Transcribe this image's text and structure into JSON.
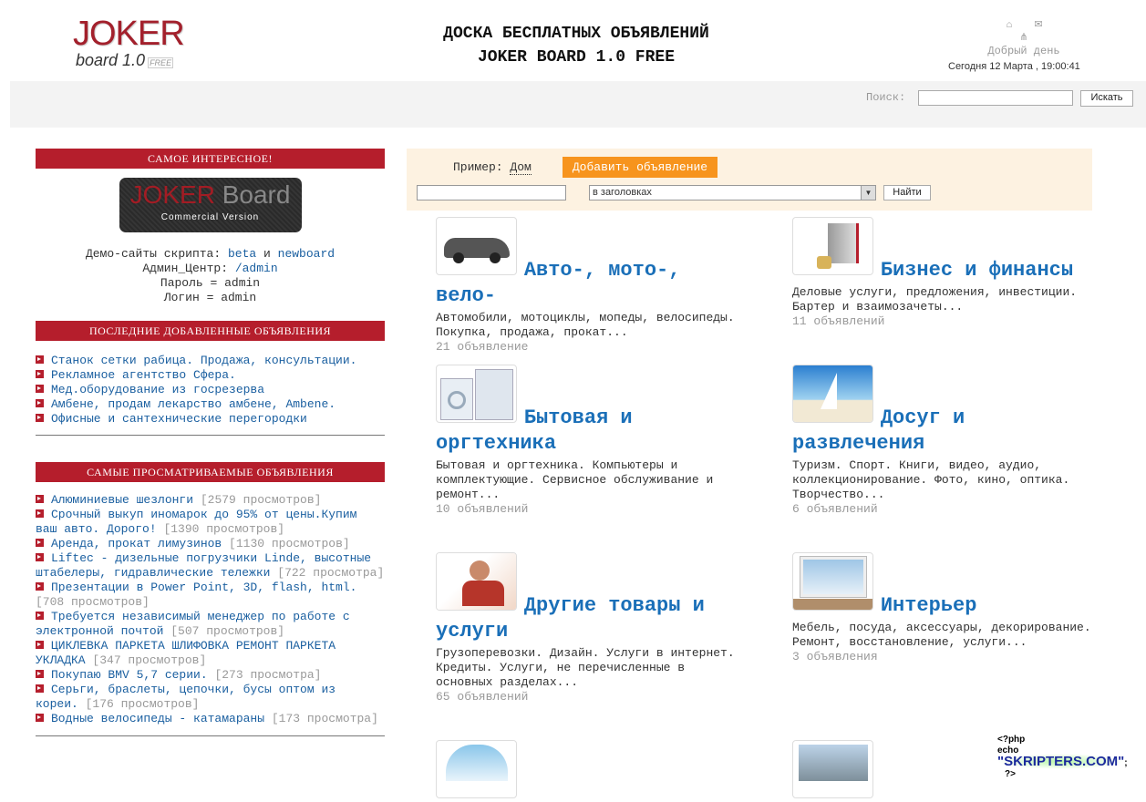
{
  "header": {
    "logo_main": "JOKER",
    "logo_sub": "board 1.0",
    "logo_badge": "FREE",
    "title_line1": "ДОСКА БЕСПЛАТНЫХ ОБЪЯВЛЕНИЙ",
    "title_line2": "JOKER BOARD 1.0 FREE",
    "greeting": "Добрый день",
    "date": "Сегодня 12 Марта , 19:00:41",
    "icons": [
      "home-icon",
      "mail-icon",
      "sitemap-icon"
    ]
  },
  "search": {
    "label": "Поиск:",
    "value": "",
    "button": "Искать"
  },
  "sidebar": {
    "interesting_title": "САМОЕ ИНТЕРЕСНОЕ!",
    "promo": {
      "word1": "JOKER",
      "word2": "Board",
      "caption": "Commercial Version"
    },
    "demo_label": "Демо-сайты скрипта:",
    "demo_link1": "beta",
    "demo_and": "и",
    "demo_link2": "newboard",
    "admin_label": "Админ_Центр:",
    "admin_link": "/admin",
    "password": "Пароль = admin",
    "login": "Логин = admin",
    "latest_title": "ПОСЛЕДНИЕ ДОБАВЛЕННЫЕ ОБЪЯВЛЕНИЯ",
    "latest": [
      "Станок сетки рабица. Продажа, консультации.",
      "Рекламное агентство Сфера.",
      "Мед.оборудование из госрезерва",
      "Амбене, продам лекарство амбене, Ambene.",
      "Офисные и сантехнические перегородки"
    ],
    "popular_title": "САМЫЕ ПРОСМАТРИВАЕМЫЕ ОБЪЯВЛЕНИЯ",
    "popular": [
      {
        "title": "Алюминиевые шезлонги",
        "views": "[2579 просмотров]"
      },
      {
        "title": "Срочный выкуп иномарок до 95% от цены.Купим ваш авто. Дорого!",
        "views": "[1390 просмотров]"
      },
      {
        "title": "Аренда, прокат лимузинов",
        "views": "[1130 просмотров]"
      },
      {
        "title": "Liftec - дизельные погрузчики Linde, высотные штабелеры, гидравлические тележки",
        "views": "[722 просмотра]"
      },
      {
        "title": "Презентации в Power Point, 3D, flash, html.",
        "views": "[708 просмотров]"
      },
      {
        "title": "Требуется независимый менеджер по работе с электронной почтой",
        "views": "[507 просмотров]"
      },
      {
        "title": "ЦИКЛЕВКА ПАРКЕТА ШЛИФОВКА РЕМОНТ ПАРКЕТА УКЛАДКА",
        "views": "[347 просмотров]"
      },
      {
        "title": "Покупаю BMV 5,7 серии.",
        "views": "[273 просмотра]"
      },
      {
        "title": "Серьги, браслеты, цепочки, бусы оптом из кореи.",
        "views": "[176 просмотров]"
      },
      {
        "title": "Водные велосипеды - катамараны",
        "views": "[173 просмотра]"
      }
    ]
  },
  "main": {
    "example_label": "Пример:",
    "example_link": "Дом",
    "add_button": "Добавить объявление",
    "query": "",
    "scope": "в заголовках",
    "find_button": "Найти",
    "categories": [
      {
        "title": "Авто-, мото-, вело-",
        "desc": "Автомобили, мотоциклы, мопеды, велосипеды. Покупка, продажа, прокат...",
        "count": "21 объявление"
      },
      {
        "title": "Бизнес и финансы",
        "desc": "Деловые услуги, предложения, инвестиции. Бартер и взаимозачеты...",
        "count": "11 объявлений"
      },
      {
        "title": "Бытовая и оргтехника",
        "desc": "Бытовая и оргтехника. Компьютеры и комплектующие. Сервисное обслуживание и ремонт...",
        "count": "10 объявлений"
      },
      {
        "title": "Досуг и развлечения",
        "desc": "Туризм. Спорт. Книги, видео, аудио, коллекционирование. Фото, кино, оптика. Творчество...",
        "count": "6 объявлений"
      },
      {
        "title": "Другие товары и услуги",
        "desc": "Грузоперевозки. Дизайн. Услуги в интернет. Кредиты. Услуги, не перечисленные в основных разделах...",
        "count": "65 объявлений"
      },
      {
        "title": "Интерьер",
        "desc": "Мебель, посуда, аксессуары, декорирование. Ремонт, восстановление, услуги...",
        "count": "3 объявления"
      }
    ]
  },
  "watermark": {
    "line1": "<?php",
    "line2a": "echo",
    "line2b": "\"SKRIPTERS.COM\"",
    "line2c": ";",
    "line3": "?>"
  },
  "colors": {
    "accent_red": "#b51e2c",
    "link_blue": "#1a6fb8",
    "orange": "#f7941d",
    "panel": "#fdf2e1"
  }
}
